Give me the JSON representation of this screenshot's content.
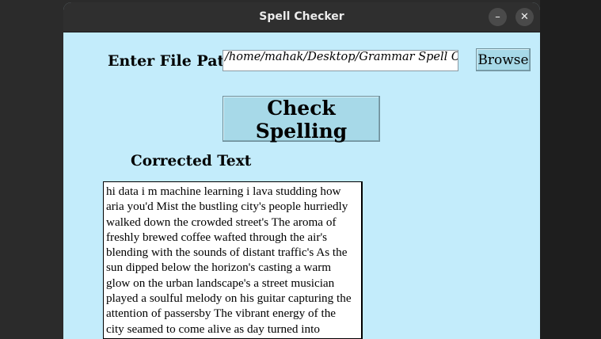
{
  "window": {
    "title": "Spell Checker",
    "minimize_glyph": "–",
    "close_glyph": "✕"
  },
  "form": {
    "path_label": "Enter File Path:",
    "path_value": "/home/mahak/Desktop/Grammar Spell Checker",
    "browse_label": "Browse",
    "check_label": "Check Spelling"
  },
  "output": {
    "heading": "Corrected Text",
    "lines": [
      "hi data i m machine learning i lava studding how",
      "aria you'd Mist the bustling city's people hurriedly",
      "walked down the crowded street's The aroma of",
      "freshly brewed coffee wafted through the air's",
      "blending with the sounds of distant traffic's As the",
      "sun dipped below the horizon's casting a warm",
      "glow on the urban landscape's a street musician",
      "played a soulful melody on his guitar capturing the",
      "attention of passersby The vibrant energy of the",
      "city seamed to come alive as day turned into"
    ]
  },
  "icons": {
    "minimize": "minimize-icon",
    "close": "close-icon"
  }
}
